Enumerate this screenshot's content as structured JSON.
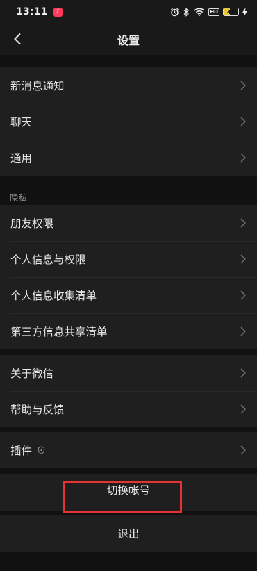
{
  "status_bar": {
    "time": "13:11",
    "app_badge_icon": "music-app-icon",
    "icons": [
      "alarm-icon",
      "bluetooth-icon",
      "wifi-icon",
      "hd-icon",
      "battery-icon",
      "charging-icon"
    ],
    "hd_label": "HD",
    "battery_level": "44",
    "battery_fraction": 0.44,
    "battery_color": "#e8c53a"
  },
  "header": {
    "back_icon": "chevron-left-icon",
    "title": "设置"
  },
  "groups": {
    "general": [
      "新消息通知",
      "聊天",
      "通用"
    ],
    "privacy_label": "隐私",
    "privacy": [
      "朋友权限",
      "个人信息与权限",
      "个人信息收集清单",
      "第三方信息共享清单"
    ],
    "about": [
      "关于微信",
      "帮助与反馈"
    ],
    "plugins": {
      "label": "插件",
      "icon": "shield-icon"
    }
  },
  "actions": {
    "switch_account": "切换帐号",
    "logout": "退出"
  },
  "colors": {
    "background": "#111111",
    "row_background": "#1f1f1f",
    "highlight": "#e53333"
  }
}
